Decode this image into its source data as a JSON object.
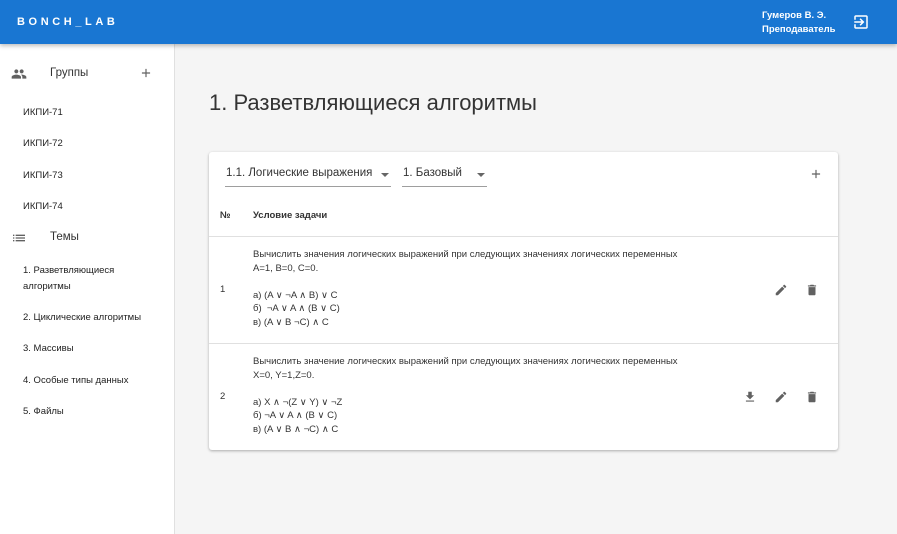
{
  "header": {
    "brand": "BONCH_LAB",
    "user_name": "Гумеров В. Э.",
    "user_role": "Преподаватель"
  },
  "sidebar": {
    "groups_label": "Группы",
    "groups": [
      "ИКПИ-71",
      "ИКПИ-72",
      "ИКПИ-73",
      "ИКПИ-74"
    ],
    "themes_label": "Темы",
    "themes": [
      "1. Разветвляющиеся\nалгоритмы",
      "2. Циклические алгоритмы",
      "3. Массивы",
      "4. Особые типы данных",
      "5. Файлы"
    ]
  },
  "main": {
    "title": "1. Разветвляющиеся алгоритмы",
    "subtopic_select": "1.1. Логические выражения",
    "level_select": "1. Базовый",
    "table": {
      "col_num": "№",
      "col_condition": "Условие задачи",
      "rows": [
        {
          "num": "1",
          "condition": "Вычислить значения логических выражений при следующих значениях логических переменных\nA=1, B=0, C=0.\n\nа) (A ∨ ¬A ∧ B) ∨ C\nб)  ¬A ∨ A ∧ (B ∨ C)\nв) (A ∨ B ¬C) ∧ C"
        },
        {
          "num": "2",
          "condition": "Вычислить значение логических выражений при следующих значениях логических переменных\nX=0, Y=1,Z=0.\n\nа) X ∧ ¬(Z ∨ Y) ∨ ¬Z\nб) ¬A ∨ A ∧ (B ∨ C)\nв) (A ∨ B ∧ ¬C) ∧ C"
        }
      ]
    }
  },
  "colors": {
    "appbar": "#1976d2",
    "icon": "#616161"
  }
}
